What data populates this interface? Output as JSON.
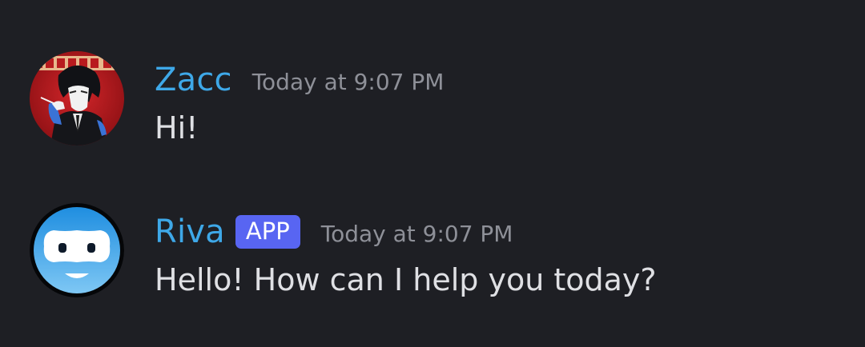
{
  "messages": [
    {
      "author": "Zacc",
      "timestamp": "Today at 9:07 PM",
      "text": "Hi!",
      "avatar": "user-avatar-illustration",
      "name_color": "#3ea8e8"
    },
    {
      "author": "Riva",
      "badge": "APP",
      "timestamp": "Today at 9:07 PM",
      "text": "Hello! How can I help you today?",
      "avatar": "bot-face-avatar",
      "name_color": "#3ea8e8",
      "badge_color": "#5865f2"
    }
  ],
  "colors": {
    "background": "#1e1f24",
    "text": "#dfe0e4",
    "muted": "#8e9098"
  }
}
